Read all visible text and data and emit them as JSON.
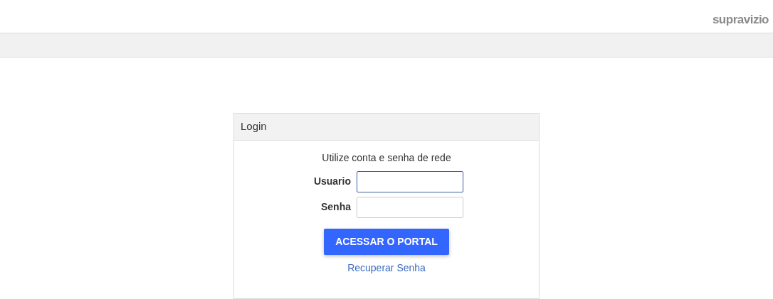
{
  "header": {
    "logo": "supravizio"
  },
  "login": {
    "title": "Login",
    "instruction": "Utilize conta e senha de rede",
    "fields": [
      {
        "label": "Usuario",
        "focused": true
      },
      {
        "label": "Senha",
        "focused": false
      }
    ],
    "submit": "ACESSAR O PORTAL",
    "recover_link": "Recuperar Senha"
  }
}
